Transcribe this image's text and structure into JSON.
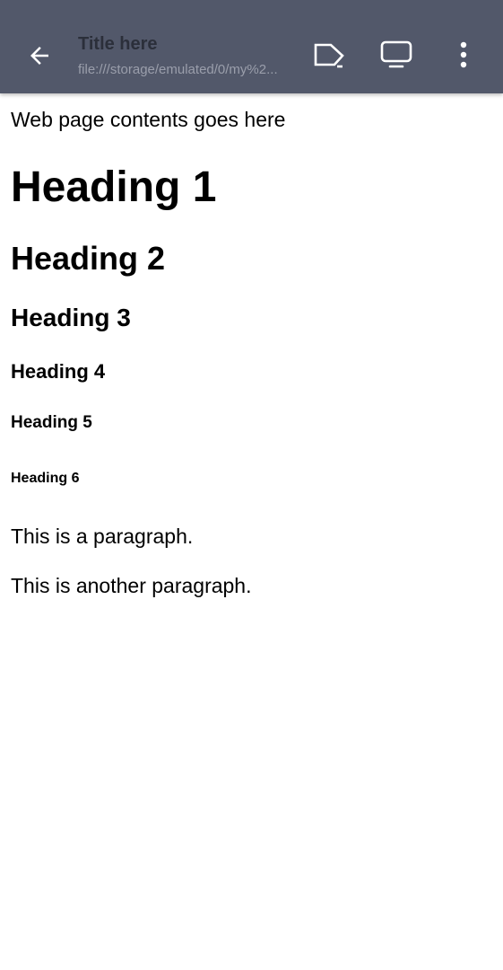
{
  "toolbar": {
    "title": "Title here",
    "url": "file:///storage/emulated/0/my%2...",
    "icons": {
      "back": "arrow-left-icon",
      "open": "open-in-app-icon",
      "device": "monitor-icon",
      "menu": "more-vertical-icon"
    },
    "colors": {
      "background": "#52586a",
      "title": "#2b2f3a",
      "url": "#9a9eab",
      "icon": "#ffffff"
    }
  },
  "page": {
    "intro": "Web page contents goes here",
    "h1": "Heading 1",
    "h2": "Heading 2",
    "h3": "Heading 3",
    "h4": "Heading 4",
    "h5": "Heading 5",
    "h6": "Heading 6",
    "paragraph1": "This is a paragraph.",
    "paragraph2": "This is another paragraph."
  }
}
